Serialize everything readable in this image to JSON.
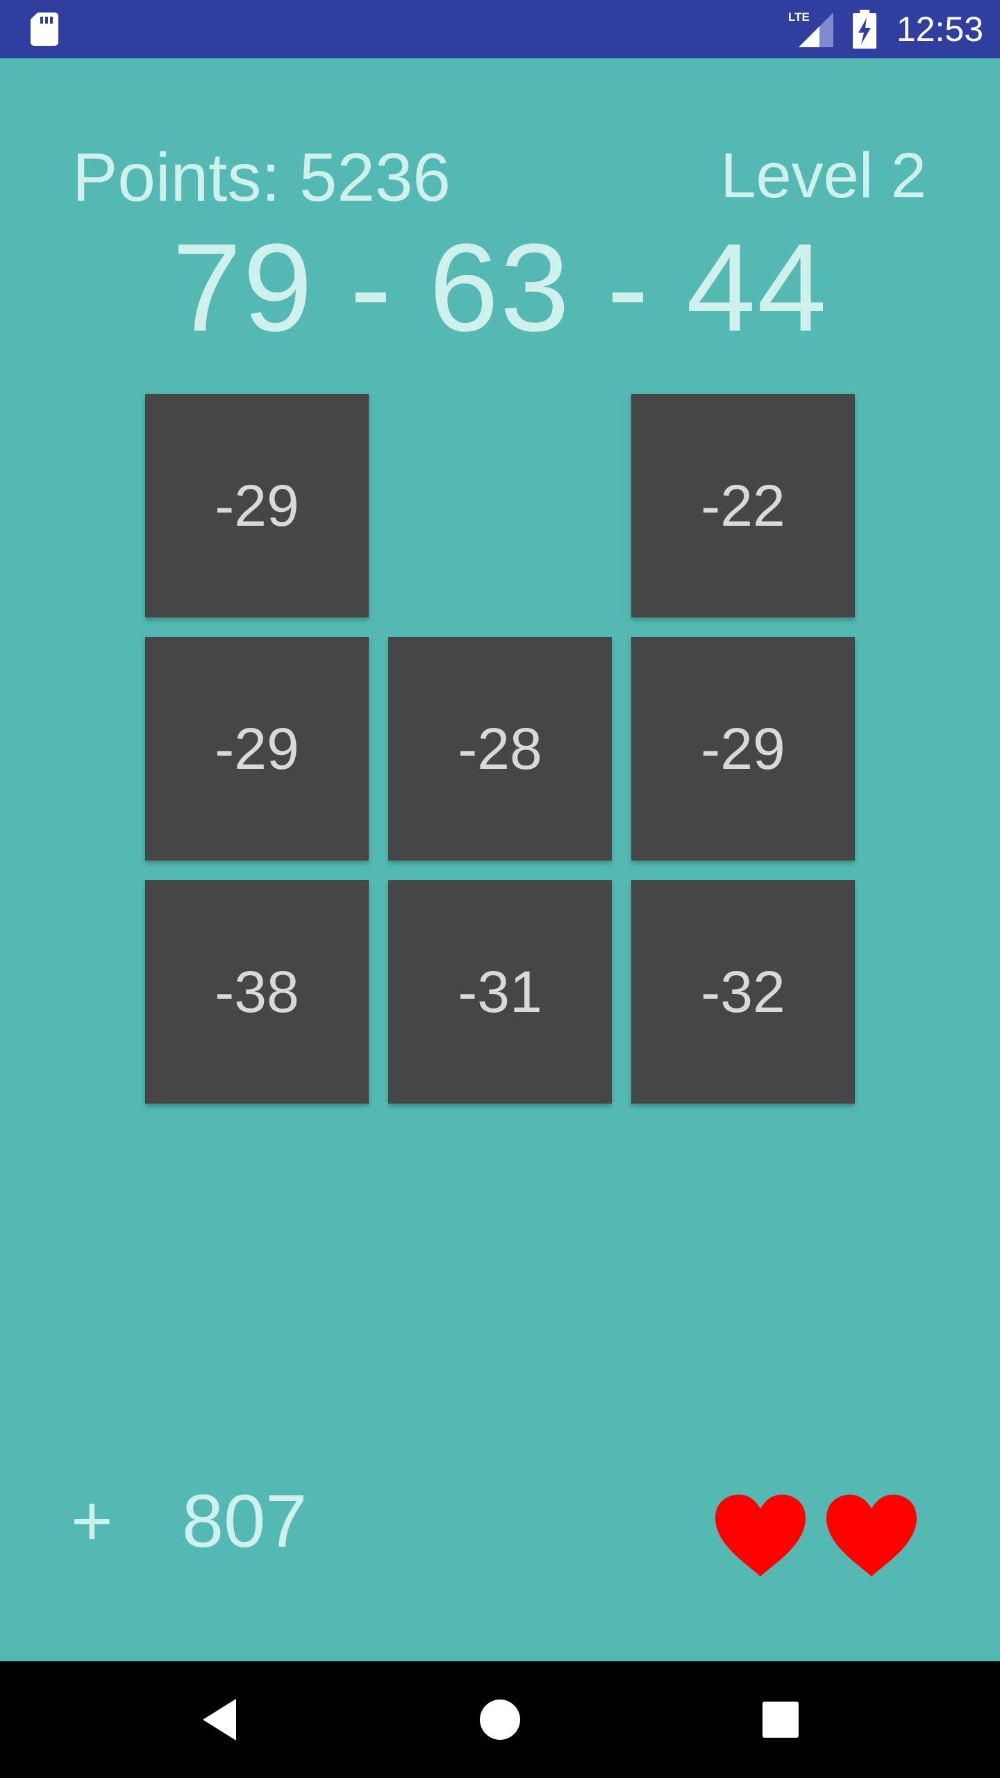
{
  "status_bar": {
    "time": "12:53",
    "icons": [
      "sd-card-icon",
      "lte-signal-icon",
      "battery-charging-icon"
    ]
  },
  "game": {
    "points_label": "Points: 5236",
    "level_label": "Level 2",
    "sequence": "79 - 63 - 44",
    "tiles": [
      {
        "value": "-29",
        "row": 1,
        "col": 1
      },
      {
        "value": "-22",
        "row": 1,
        "col": 3
      },
      {
        "value": "-29",
        "row": 2,
        "col": 1
      },
      {
        "value": "-28",
        "row": 2,
        "col": 2
      },
      {
        "value": "-29",
        "row": 2,
        "col": 3
      },
      {
        "value": "-38",
        "row": 3,
        "col": 1
      },
      {
        "value": "-31",
        "row": 3,
        "col": 2
      },
      {
        "value": "-32",
        "row": 3,
        "col": 3
      }
    ],
    "bonus_sign": "+",
    "bonus_value": "807",
    "lives": 2
  },
  "colors": {
    "background": "#53b9b2",
    "status_bar": "#303f9f",
    "tile": "#464646",
    "heart": "#ff0000",
    "text": "#d0f0ec"
  },
  "nav_bar": {
    "buttons": [
      "back-icon",
      "home-icon",
      "recents-icon"
    ]
  }
}
